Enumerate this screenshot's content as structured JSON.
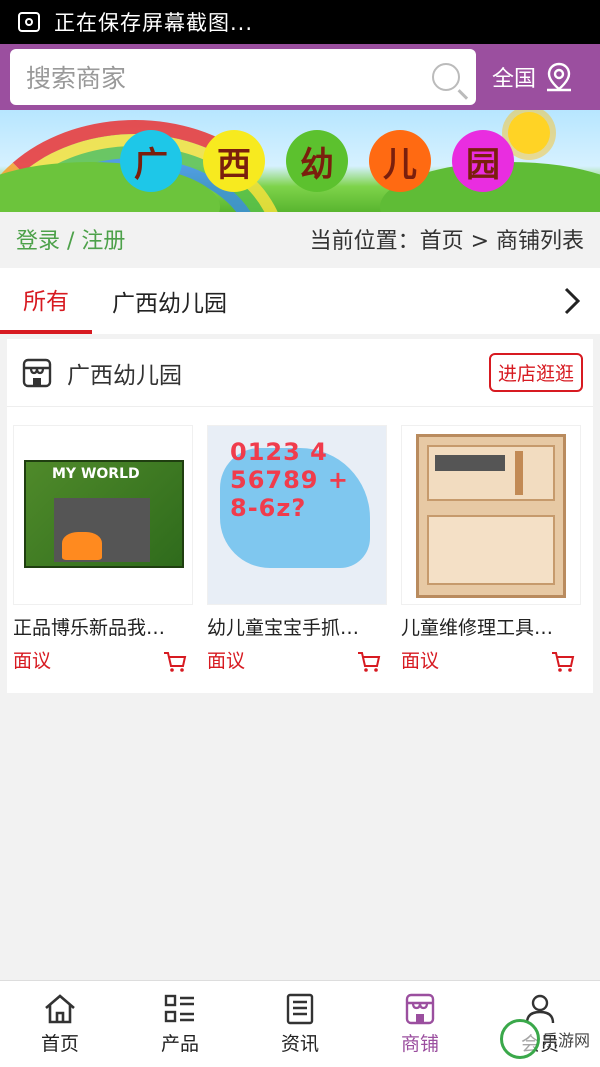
{
  "statusbar": {
    "text": "正在保存屏幕截图..."
  },
  "header": {
    "search_placeholder": "搜索商家",
    "region": "全国"
  },
  "banner": {
    "chars": [
      "广",
      "西",
      "幼",
      "儿",
      "园"
    ],
    "colors": [
      "#1ec7e8",
      "#f7ea1f",
      "#5cc12e",
      "#ff6a12",
      "#e92de0"
    ]
  },
  "location": {
    "login": "登录 / 注册",
    "breadcrumb": "当前位置：首页 > 商铺列表"
  },
  "tabs": {
    "all": "所有",
    "category": "广西幼儿园"
  },
  "shop": {
    "name": "广西幼儿园",
    "visit_label": "进店逛逛",
    "products": [
      {
        "name": "正品博乐新品我…",
        "price": "面议",
        "img_logo": "MY WORLD"
      },
      {
        "name": "幼儿童宝宝手抓…",
        "price": "面议",
        "img_nums": "0123 4 56789 + 8-6z?"
      },
      {
        "name": "儿童维修理工具…",
        "price": "面议"
      }
    ]
  },
  "nav": {
    "items": [
      {
        "label": "首页",
        "icon": "home-icon"
      },
      {
        "label": "产品",
        "icon": "list-icon"
      },
      {
        "label": "资讯",
        "icon": "news-icon"
      },
      {
        "label": "商铺",
        "icon": "shop-icon"
      },
      {
        "label": "会员",
        "icon": "user-icon"
      }
    ],
    "active": "商铺"
  },
  "theme": {
    "accent": "#9b4f9f",
    "price_red": "#d71a21",
    "login_green": "#4da14a"
  },
  "watermark": {
    "text": "乐游网"
  }
}
